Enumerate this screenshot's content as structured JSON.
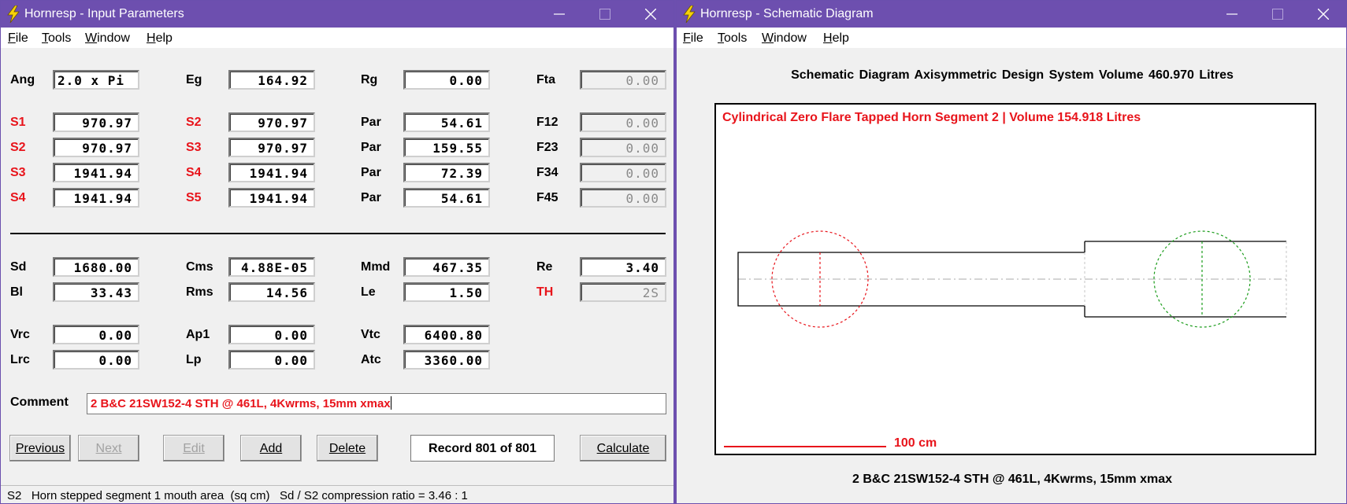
{
  "left_window": {
    "title": "Hornresp - Input Parameters",
    "menu": [
      "File",
      "Tools",
      "Window",
      "Help"
    ],
    "rows": [
      [
        [
          "Ang",
          "2.0 x Pi"
        ],
        [
          "Eg",
          "164.92"
        ],
        [
          "Rg",
          "0.00"
        ],
        [
          "Fta",
          "0.00"
        ]
      ],
      [
        [
          "S1",
          "970.97"
        ],
        [
          "S2",
          "970.97"
        ],
        [
          "Par",
          "54.61"
        ],
        [
          "F12",
          "0.00"
        ]
      ],
      [
        [
          "S2",
          "970.97"
        ],
        [
          "S3",
          "970.97"
        ],
        [
          "Par",
          "159.55"
        ],
        [
          "F23",
          "0.00"
        ]
      ],
      [
        [
          "S3",
          "1941.94"
        ],
        [
          "S4",
          "1941.94"
        ],
        [
          "Par",
          "72.39"
        ],
        [
          "F34",
          "0.00"
        ]
      ],
      [
        [
          "S4",
          "1941.94"
        ],
        [
          "S5",
          "1941.94"
        ],
        [
          "Par",
          "54.61"
        ],
        [
          "F45",
          "0.00"
        ]
      ],
      [
        [
          "Sd",
          "1680.00"
        ],
        [
          "Cms",
          "4.88E-05"
        ],
        [
          "Mmd",
          "467.35"
        ],
        [
          "Re",
          "3.40"
        ]
      ],
      [
        [
          "Bl",
          "33.43"
        ],
        [
          "Rms",
          "14.56"
        ],
        [
          "Le",
          "1.50"
        ],
        [
          "TH",
          "2S"
        ]
      ],
      [
        [
          "Vrc",
          "0.00"
        ],
        [
          "Ap1",
          "0.00"
        ],
        [
          "Vtc",
          "6400.80"
        ]
      ],
      [
        [
          "Lrc",
          "0.00"
        ],
        [
          "Lp",
          "0.00"
        ],
        [
          "Atc",
          "3360.00"
        ]
      ]
    ],
    "comment_label": "Comment",
    "comment_value": "2 B&C 21SW152-4 STH @ 461L, 4Kwrms, 15mm xmax",
    "buttons": {
      "previous": "Previous",
      "next": "Next",
      "edit": "Edit",
      "add": "Add",
      "delete": "Delete",
      "calculate": "Calculate"
    },
    "record": "Record 801 of 801",
    "status": "S2   Horn stepped segment 1 mouth area  (sq cm)   Sd / S2 compression ratio = 3.46 : 1"
  },
  "right_window": {
    "title": "Hornresp - Schematic Diagram",
    "menu": [
      "File",
      "Tools",
      "Window",
      "Help"
    ],
    "header": "Schematic Diagram   Axisymmetric Design   System Volume 460.970 Litres",
    "plot_title": "Cylindrical Zero Flare Tapped Horn Segment 2 | Volume 154.918 Litres",
    "scale_label": "100 cm",
    "footer": "2 B&C 21SW152-4 STH @ 461L, 4Kwrms, 15mm xmax"
  },
  "colors": {
    "titlebar": "#6d4faf",
    "label_red": "#e8141b",
    "driver_red": "#e8141b",
    "driver_green": "#1a9c1a",
    "centerline": "#a8a8a8"
  }
}
